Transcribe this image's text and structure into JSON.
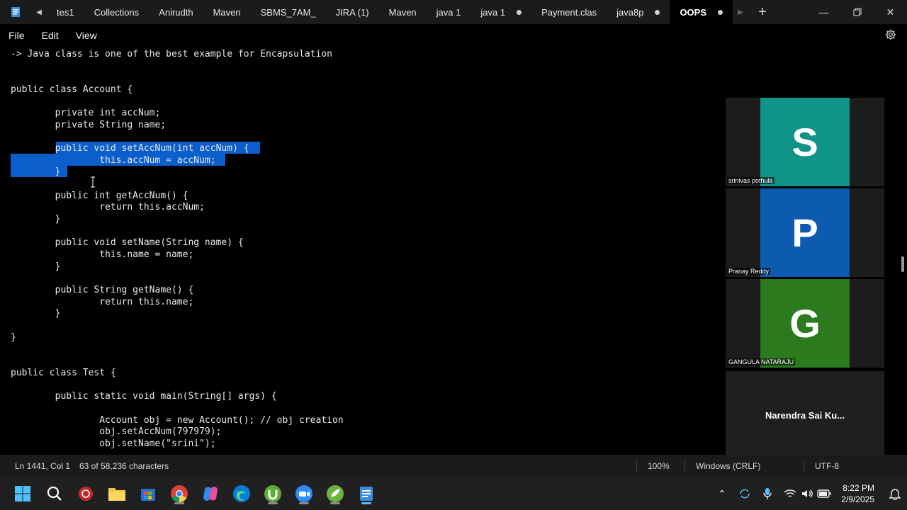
{
  "tabs": [
    {
      "label": "tes1",
      "dot": false,
      "active": false
    },
    {
      "label": "Collections",
      "dot": false,
      "active": false
    },
    {
      "label": "Anirudth",
      "dot": false,
      "active": false
    },
    {
      "label": "Maven",
      "dot": false,
      "active": false
    },
    {
      "label": "SBMS_7AM_",
      "dot": false,
      "active": false
    },
    {
      "label": "JIRA (1)",
      "dot": false,
      "active": false
    },
    {
      "label": "Maven",
      "dot": false,
      "active": false
    },
    {
      "label": "java 1",
      "dot": false,
      "active": false
    },
    {
      "label": "java 1",
      "dot": true,
      "active": false
    },
    {
      "label": "Payment.clas",
      "dot": false,
      "active": false
    },
    {
      "label": "java8p",
      "dot": true,
      "active": false
    },
    {
      "label": "OOPS",
      "dot": true,
      "active": true
    }
  ],
  "menu": {
    "file": "File",
    "edit": "Edit",
    "view": "View"
  },
  "code_lines": [
    "-> Java class is one of the best example for Encapsulation",
    "",
    "",
    "public class Account {",
    "",
    "        private int accNum;",
    "        private String name;",
    "",
    "        public void setAccNum(int accNum) {",
    "                this.accNum = accNum;",
    "        }",
    "",
    "        public int getAccNum() {",
    "                return this.accNum;",
    "        }",
    "",
    "        public void setName(String name) {",
    "                this.name = name;",
    "        }",
    "",
    "        public String getName() {",
    "                return this.name;",
    "        }",
    "",
    "}",
    "",
    "",
    "public class Test {",
    "",
    "        public static void main(String[] args) {",
    "",
    "                Account obj = new Account(); // obj creation",
    "                obj.setAccNum(797979);",
    "                obj.setName(\"srini\");"
  ],
  "participants": [
    {
      "initial": "S",
      "name": "srinivas pothula",
      "color": "#0f9487"
    },
    {
      "initial": "P",
      "name": "Pranay Reddy",
      "color": "#0c5bb0"
    },
    {
      "initial": "G",
      "name": "GANGULA NATARAJU",
      "color": "#2b7a1d"
    }
  ],
  "participant_text_only": "Narendra Sai Ku...",
  "status": {
    "position": "Ln 1441, Col 1",
    "chars": "63 of 58,236 characters",
    "zoom": "100%",
    "line_ending": "Windows (CRLF)",
    "encoding": "UTF-8"
  },
  "clock": {
    "time": "8:22 PM",
    "date": "2/9/2025"
  },
  "colors": {
    "selection": "#0a5fcc",
    "editor_bg": "#000000",
    "titlebar_bg": "#1b1b1b"
  }
}
